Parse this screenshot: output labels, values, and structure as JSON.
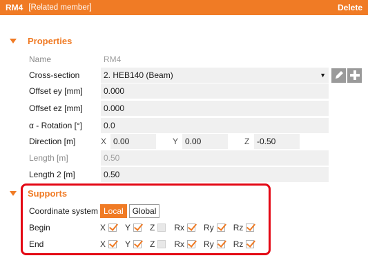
{
  "header": {
    "id": "RM4",
    "type": "[Related member]",
    "delete_label": "Delete"
  },
  "properties": {
    "title": "Properties",
    "name": {
      "label": "Name",
      "value": "RM4"
    },
    "cross_section": {
      "label": "Cross-section",
      "value": "2. HEB140 (Beam)",
      "edit_icon": "pencil-icon",
      "add_icon": "plus-icon"
    },
    "offset_ey": {
      "label": "Offset ey [mm]",
      "value": "0.000"
    },
    "offset_ez": {
      "label": "Offset ez [mm]",
      "value": "0.000"
    },
    "rotation": {
      "label": "α - Rotation [°]",
      "value": "0.0"
    },
    "direction": {
      "label": "Direction [m]",
      "x_label": "X",
      "x": "0.00",
      "y_label": "Y",
      "y": "0.00",
      "z_label": "Z",
      "z": "-0.50"
    },
    "length": {
      "label": "Length [m]",
      "value": "0.50"
    },
    "length2": {
      "label": "Length 2 [m]",
      "value": "0.50"
    }
  },
  "supports": {
    "title": "Supports",
    "coord_label": "Coordinate system",
    "local_label": "Local",
    "global_label": "Global",
    "selected": "Local",
    "begin": {
      "label": "Begin",
      "checks": [
        {
          "axis": "X",
          "checked": true
        },
        {
          "axis": "Y",
          "checked": true
        },
        {
          "axis": "Z",
          "checked": false
        },
        {
          "axis": "Rx",
          "checked": true
        },
        {
          "axis": "Ry",
          "checked": true
        },
        {
          "axis": "Rz",
          "checked": true
        }
      ]
    },
    "end": {
      "label": "End",
      "checks": [
        {
          "axis": "X",
          "checked": true
        },
        {
          "axis": "Y",
          "checked": true
        },
        {
          "axis": "Z",
          "checked": false
        },
        {
          "axis": "Rx",
          "checked": true
        },
        {
          "axis": "Ry",
          "checked": true
        },
        {
          "axis": "Rz",
          "checked": true
        }
      ]
    }
  },
  "colors": {
    "accent": "#f07b25",
    "highlight": "#e30613"
  }
}
